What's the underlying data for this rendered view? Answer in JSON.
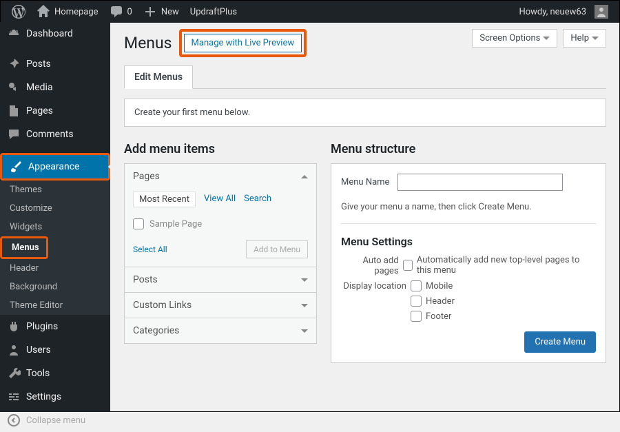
{
  "adminbar": {
    "home_label": "Homepage",
    "comments_count": "0",
    "new_label": "New",
    "updraft_label": "UpdraftPlus",
    "howdy": "Howdy, neuew63"
  },
  "sidebar": {
    "dashboard": "Dashboard",
    "posts": "Posts",
    "media": "Media",
    "pages": "Pages",
    "comments": "Comments",
    "appearance": "Appearance",
    "plugins": "Plugins",
    "users": "Users",
    "tools": "Tools",
    "settings": "Settings",
    "collapse": "Collapse menu",
    "submenu": {
      "themes": "Themes",
      "customize": "Customize",
      "widgets": "Widgets",
      "menus": "Menus",
      "header": "Header",
      "background": "Background",
      "theme_editor": "Theme Editor"
    }
  },
  "topbtns": {
    "screen_options": "Screen Options",
    "help": "Help"
  },
  "header": {
    "title": "Menus",
    "live_preview": "Manage with Live Preview"
  },
  "tab_label": "Edit Menus",
  "notice": "Create your first menu below.",
  "left": {
    "heading": "Add menu items",
    "pages_label": "Pages",
    "subtabs": {
      "most_recent": "Most Recent",
      "view_all": "View All",
      "search": "Search"
    },
    "sample_page": "Sample Page",
    "select_all": "Select All",
    "add_to_menu": "Add to Menu",
    "posts_label": "Posts",
    "custom_links_label": "Custom Links",
    "categories_label": "Categories"
  },
  "right": {
    "heading": "Menu structure",
    "name_label": "Menu Name",
    "hint": "Give your menu a name, then click Create Menu.",
    "settings_heading": "Menu Settings",
    "auto_add_label": "Auto add pages",
    "auto_add_opt": "Automatically add new top-level pages to this menu",
    "display_loc_label": "Display location",
    "loc_mobile": "Mobile",
    "loc_header": "Header",
    "loc_footer": "Footer",
    "create_btn": "Create Menu"
  }
}
